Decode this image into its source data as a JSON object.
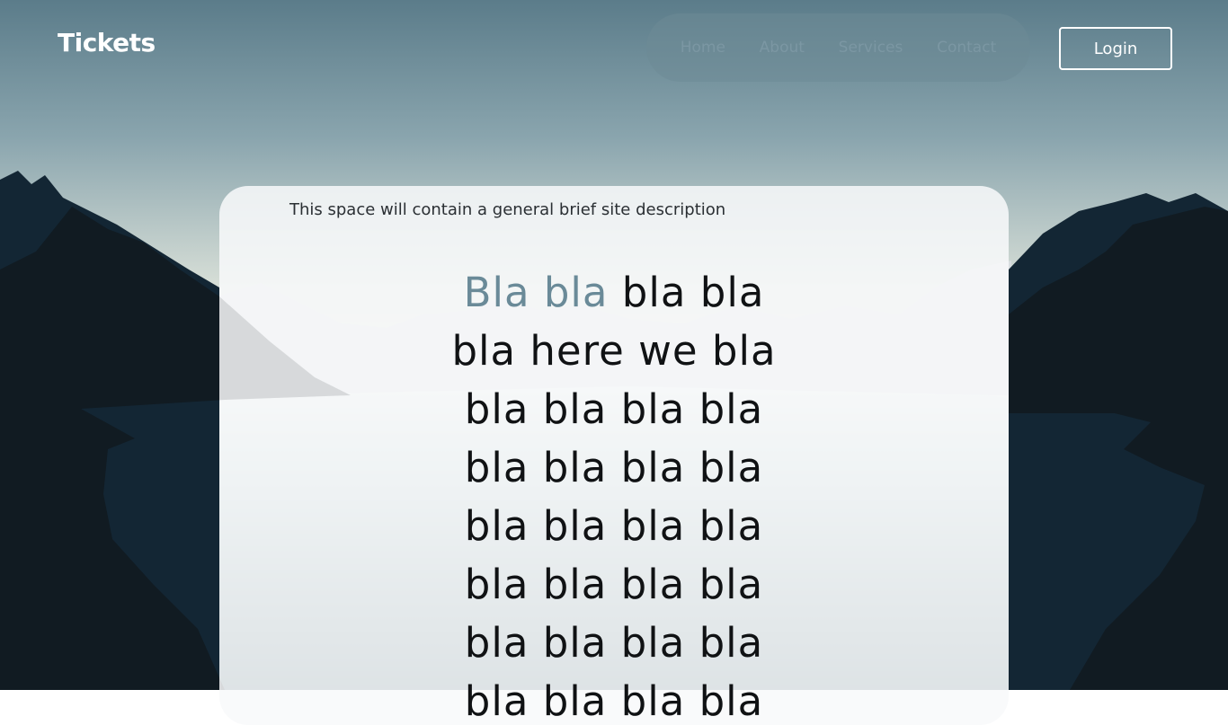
{
  "brand": {
    "logo": "Tickets"
  },
  "nav": {
    "items": [
      {
        "label": "Home"
      },
      {
        "label": "About"
      },
      {
        "label": "Services"
      },
      {
        "label": "Contact"
      }
    ]
  },
  "login": {
    "label": "Login"
  },
  "card": {
    "description": "This space will contain a general brief site description",
    "hero": {
      "highlight": "Bla bla",
      "first_rest": " bla bla",
      "lines": [
        "bla here we bla",
        "bla bla bla bla",
        "bla bla bla bla",
        "bla bla bla bla",
        "bla bla bla bla",
        "bla bla bla bla",
        "bla bla bla bla"
      ]
    }
  },
  "colors": {
    "accent": "#6a8a98",
    "sky_top": "#5e7f8c",
    "mountains_dark": "#111b22"
  }
}
